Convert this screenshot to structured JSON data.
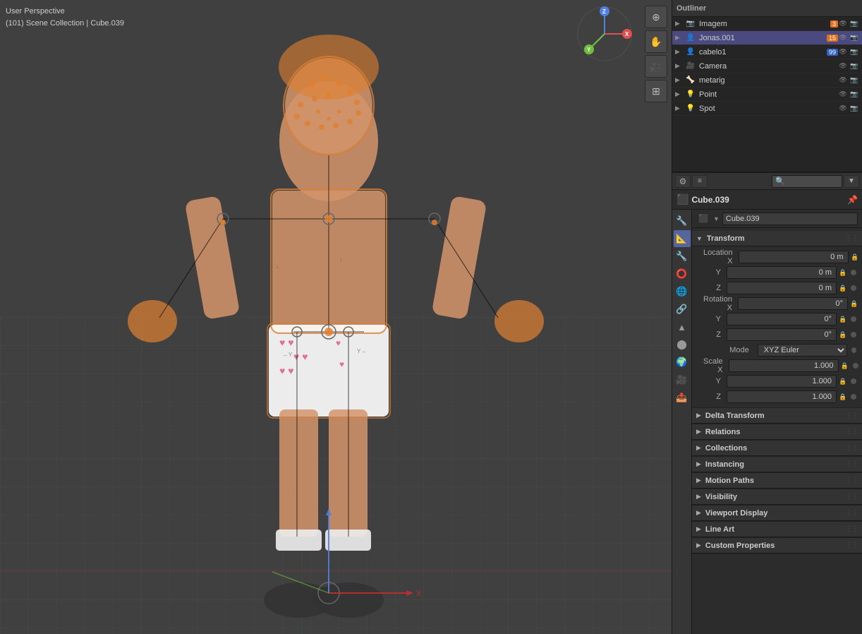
{
  "viewport": {
    "info_line1": "User Perspective",
    "info_line2": "(101) Scene Collection | Cube.039"
  },
  "outliner": {
    "rows": [
      {
        "id": "imagem",
        "label": "Imagem",
        "indent": 0,
        "icon": "📷",
        "badge": "3",
        "badge_type": "orange"
      },
      {
        "id": "jonas001",
        "label": "Jonas.001",
        "indent": 0,
        "icon": "👤",
        "badge": "15",
        "badge_type": "orange"
      },
      {
        "id": "cabelo1",
        "label": "cabelo1",
        "indent": 0,
        "icon": "👤",
        "badge": "99",
        "badge_type": "blue"
      },
      {
        "id": "camera",
        "label": "Camera",
        "indent": 0,
        "icon": "🎥",
        "badge": "",
        "badge_type": ""
      },
      {
        "id": "metarig",
        "label": "metarig",
        "indent": 0,
        "icon": "🦴",
        "badge": "",
        "badge_type": ""
      },
      {
        "id": "point",
        "label": "Point",
        "indent": 0,
        "icon": "💡",
        "badge": "",
        "badge_type": ""
      },
      {
        "id": "spot",
        "label": "Spot",
        "indent": 0,
        "icon": "💡",
        "badge": "",
        "badge_type": ""
      }
    ]
  },
  "props_panel": {
    "object_name": "Cube.039",
    "object_name_input": "Cube.039",
    "search_placeholder": "🔍",
    "sidebar_icons": [
      "🔧",
      "📐",
      "🎨",
      "🌐",
      "⚙️",
      "🔩",
      "🎯",
      "⭕",
      "🔴",
      "🟡",
      "🔗"
    ],
    "transform": {
      "title": "Transform",
      "location": {
        "x_label": "Location X",
        "x_value": "0 m",
        "y_label": "Y",
        "y_value": "0 m",
        "z_label": "Z",
        "z_value": "0 m"
      },
      "rotation": {
        "x_label": "Rotation X",
        "x_value": "0°",
        "y_label": "Y",
        "y_value": "0°",
        "z_label": "Z",
        "z_value": "0°",
        "mode_label": "Mode",
        "mode_value": "XYZ Euler"
      },
      "scale": {
        "x_label": "Scale X",
        "x_value": "1.000",
        "y_label": "Y",
        "y_value": "1.000",
        "z_label": "Z",
        "z_value": "1.000"
      }
    },
    "sections": [
      {
        "id": "delta-transform",
        "label": "Delta Transform"
      },
      {
        "id": "relations",
        "label": "Relations"
      },
      {
        "id": "collections",
        "label": "Collections"
      },
      {
        "id": "instancing",
        "label": "Instancing"
      },
      {
        "id": "motion-paths",
        "label": "Motion Paths"
      },
      {
        "id": "visibility",
        "label": "Visibility"
      },
      {
        "id": "viewport-display",
        "label": "Viewport Display"
      },
      {
        "id": "line-art",
        "label": "Line Art"
      },
      {
        "id": "custom-properties",
        "label": "Custom Properties"
      }
    ]
  },
  "gizmo": {
    "x_label": "X",
    "y_label": "Y",
    "z_label": "Z"
  },
  "viewport_buttons": [
    {
      "id": "add-btn",
      "icon": "+"
    },
    {
      "id": "hand-btn",
      "icon": "✋"
    },
    {
      "id": "camera-btn",
      "icon": "🎥"
    },
    {
      "id": "grid-btn",
      "icon": "⊞"
    }
  ]
}
